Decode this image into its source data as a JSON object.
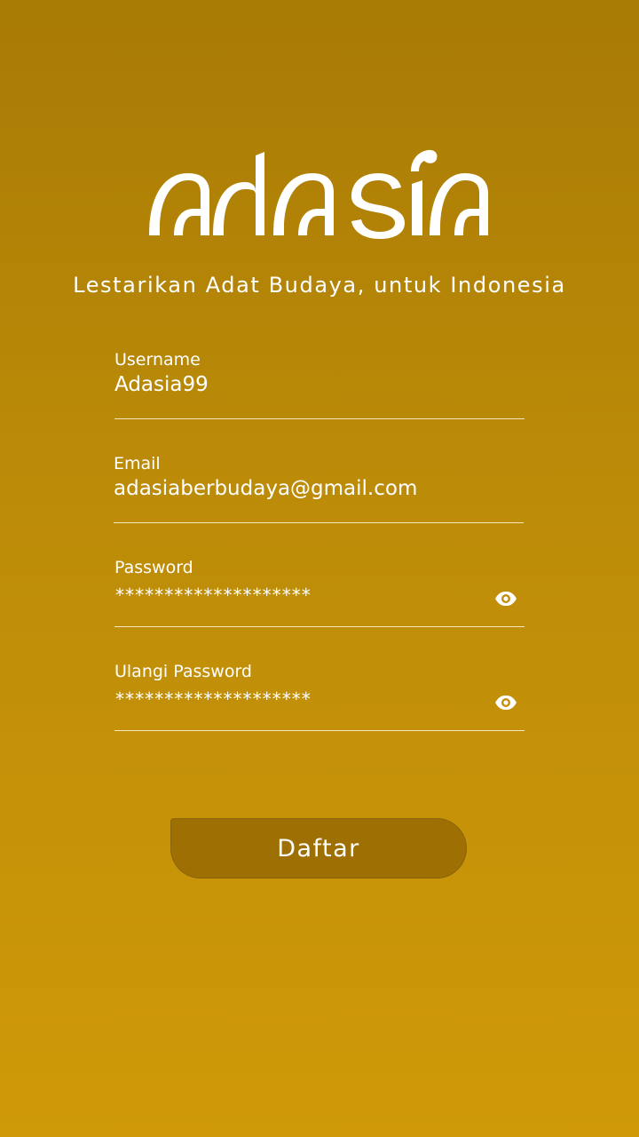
{
  "app": {
    "logo_text": "adasia",
    "tagline": "Lestarikan Adat Budaya, untuk Indonesia"
  },
  "form": {
    "username": {
      "label": "Username",
      "value": "Adasia99"
    },
    "email": {
      "label": "Email",
      "value": "adasiaberbudaya@gmail.com"
    },
    "password": {
      "label": "Password",
      "value": "********************",
      "icon": "eye-icon"
    },
    "confirm_password": {
      "label": "Ulangi Password",
      "value": "********************",
      "icon": "eye-icon"
    },
    "submit_label": "Daftar"
  },
  "colors": {
    "background_top": "#a87b05",
    "background_bottom": "#cf9908",
    "button": "#9e6f03",
    "text": "#ffffff"
  }
}
